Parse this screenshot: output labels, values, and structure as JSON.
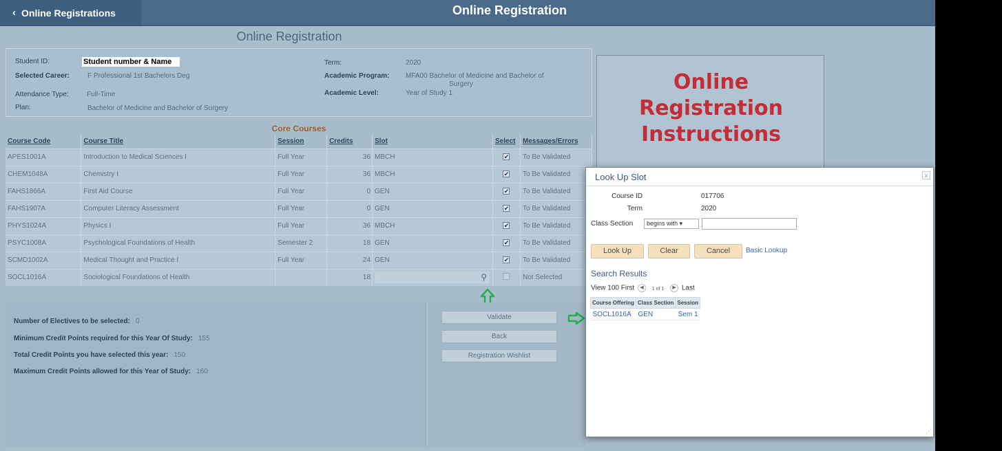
{
  "header": {
    "back_label": "Online Registrations",
    "title": "Online Registration"
  },
  "page_heading": "Online Registration",
  "student": {
    "id_label": "Student ID:",
    "id_value": "Student number & Name",
    "career_label": "Selected Career:",
    "career_value": "F  Professional 1st Bachelors Deg",
    "attendance_label": "Attendance Type:",
    "attendance_value": "Full-Time",
    "plan_label": "Plan:",
    "plan_value": "Bachelor of Medicine and Bachelor of Surgery",
    "term_label": "Term:",
    "term_value": "2020",
    "program_label": "Academic Program:",
    "program_value_line1": "MFA00 Bachelor of Medicine and Bachelor of",
    "program_value_line2": "Surgery",
    "level_label": "Academic Level:",
    "level_value": "Year of Study 1"
  },
  "core_courses": {
    "title": "Core Courses",
    "columns": [
      "Course Code",
      "Course Title",
      "Session",
      "Credits",
      "Slot",
      "Select",
      "Messages/Errors"
    ],
    "rows": [
      {
        "code": "APES1001A",
        "title": "Introduction to Medical Sciences I",
        "session": "Full Year",
        "credits": "36",
        "slot": "MBCH",
        "select": "✔",
        "message": "To Be Validated"
      },
      {
        "code": "CHEM1048A",
        "title": "Chemistry I",
        "session": "Full Year",
        "credits": "36",
        "slot": "MBCH",
        "select": "✔",
        "message": "To Be Validated"
      },
      {
        "code": "FAHS1866A",
        "title": "First Aid Course",
        "session": "Full Year",
        "credits": "0",
        "slot": "GEN",
        "select": "✔",
        "message": "To Be Validated"
      },
      {
        "code": "FAHS1907A",
        "title": "Computer Literacy Assessment",
        "session": "Full Year",
        "credits": "0",
        "slot": "GEN",
        "select": "✔",
        "message": "To Be Validated"
      },
      {
        "code": "PHYS1024A",
        "title": "Physics I",
        "session": "Full Year",
        "credits": "36",
        "slot": "MBCH",
        "select": "✔",
        "message": "To Be Validated"
      },
      {
        "code": "PSYC1008A",
        "title": "Psychological Foundations of Health",
        "session": "Semester 2",
        "credits": "18",
        "slot": "GEN",
        "select": "✔",
        "message": "To Be Validated"
      },
      {
        "code": "SCMD1002A",
        "title": "Medical Thought and Practice I",
        "session": "Full Year",
        "credits": "24",
        "slot": "GEN",
        "select": "✔",
        "message": "To Be Validated"
      },
      {
        "code": "SOCL1016A",
        "title": "Sociological Foundations of Health",
        "session": "",
        "credits": "18",
        "slot": "",
        "select": "",
        "message": "Not Selected"
      }
    ]
  },
  "stats": {
    "electives_label": "Number of Electives to be selected:",
    "electives_value": "0",
    "min_label": "Minimum Credit Points required for this Year Of Study:",
    "min_value": "155",
    "total_label": "Total Credit Points you have selected this year:",
    "total_value": "150",
    "max_label": "Maximum Credit Points allowed for this Year of Study:",
    "max_value": "160"
  },
  "actions": {
    "validate": "Validate",
    "back": "Back",
    "wishlist": "Registration Wishlist"
  },
  "instructions": {
    "line1": "Online",
    "line2": "Registration",
    "line3": "Instructions"
  },
  "modal": {
    "title": "Look Up Slot",
    "close": "x",
    "course_id_label": "Course ID",
    "course_id_value": "017706",
    "term_label": "Term",
    "term_value": "2020",
    "class_section_label": "Class Section",
    "class_section_operator": "begins with",
    "lookup_btn": "Look Up",
    "clear_btn": "Clear",
    "cancel_btn": "Cancel",
    "basic_lookup": "Basic Lookup",
    "results_title": "Search Results",
    "pager": {
      "view": "View 100",
      "first": "First",
      "range": "1 of 1",
      "last": "Last"
    },
    "results_columns": [
      "Course Offering",
      "Class Section",
      "Session"
    ],
    "results_rows": [
      {
        "offering": "SOCL1016A",
        "section": "GEN",
        "session": "Sem 1"
      }
    ]
  }
}
